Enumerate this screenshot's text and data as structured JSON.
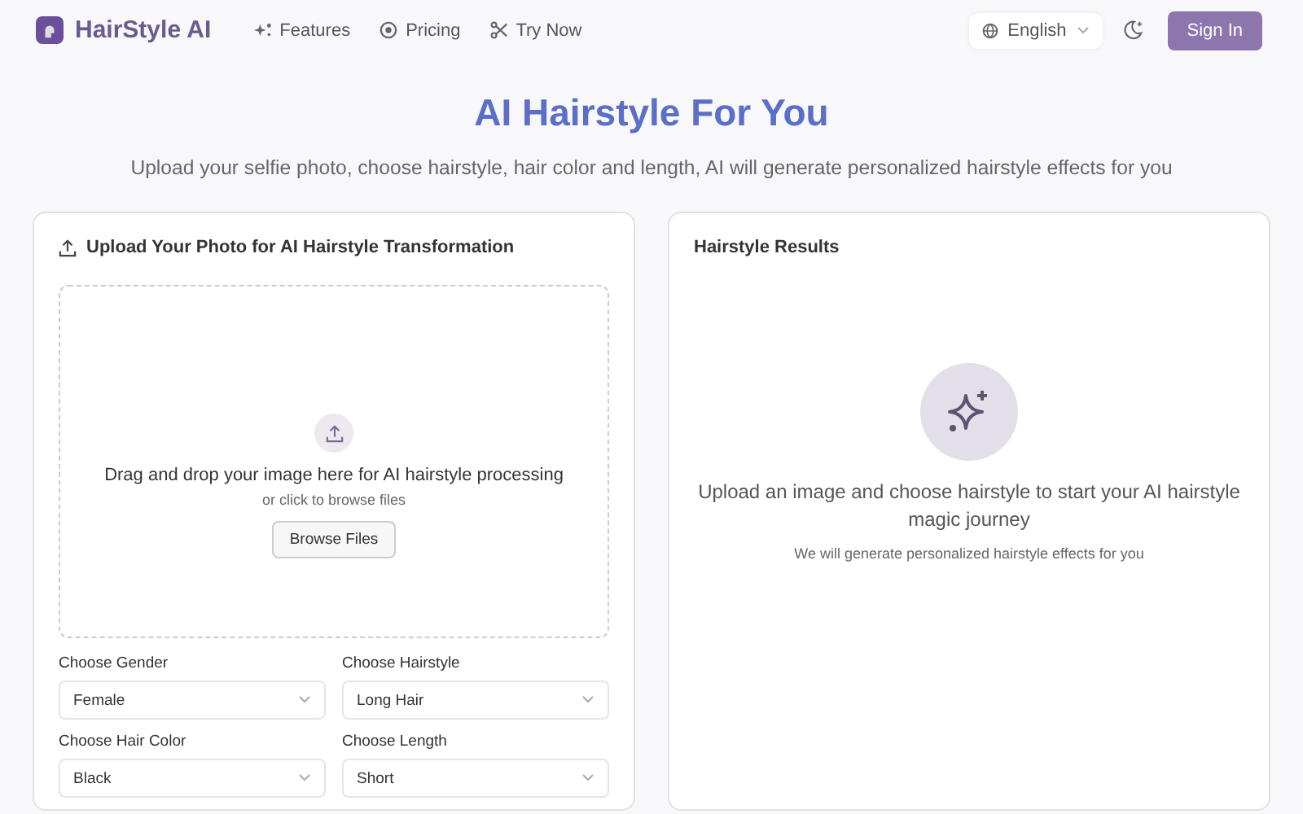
{
  "header": {
    "brand": "HairStyle AI",
    "nav": [
      {
        "kind": "sparkle",
        "label": "Features"
      },
      {
        "kind": "coin",
        "label": "Pricing"
      },
      {
        "kind": "scissors",
        "label": "Try Now"
      }
    ],
    "language": "English",
    "sign_in": "Sign In"
  },
  "hero": {
    "title": "AI Hairstyle For You",
    "subtitle": "Upload your selfie photo, choose hairstyle, hair color and length, AI will generate personalized hairstyle effects for you"
  },
  "upload_card": {
    "title": "Upload Your Photo for AI Hairstyle Transformation",
    "dropzone": {
      "heading": "Drag and drop your image here for AI hairstyle processing",
      "hint": "or click to browse files",
      "button": "Browse Files"
    },
    "selects": [
      {
        "label": "Choose Gender",
        "value": "Female"
      },
      {
        "label": "Choose Hairstyle",
        "value": "Long Hair"
      },
      {
        "label": "Choose Hair Color",
        "value": "Black"
      },
      {
        "label": "Choose Length",
        "value": "Short"
      }
    ]
  },
  "results_card": {
    "title": "Hairstyle Results",
    "message": "Upload an image and choose hairstyle to start your AI hairstyle magic journey",
    "note": "We will generate personalized hairstyle effects for you"
  }
}
